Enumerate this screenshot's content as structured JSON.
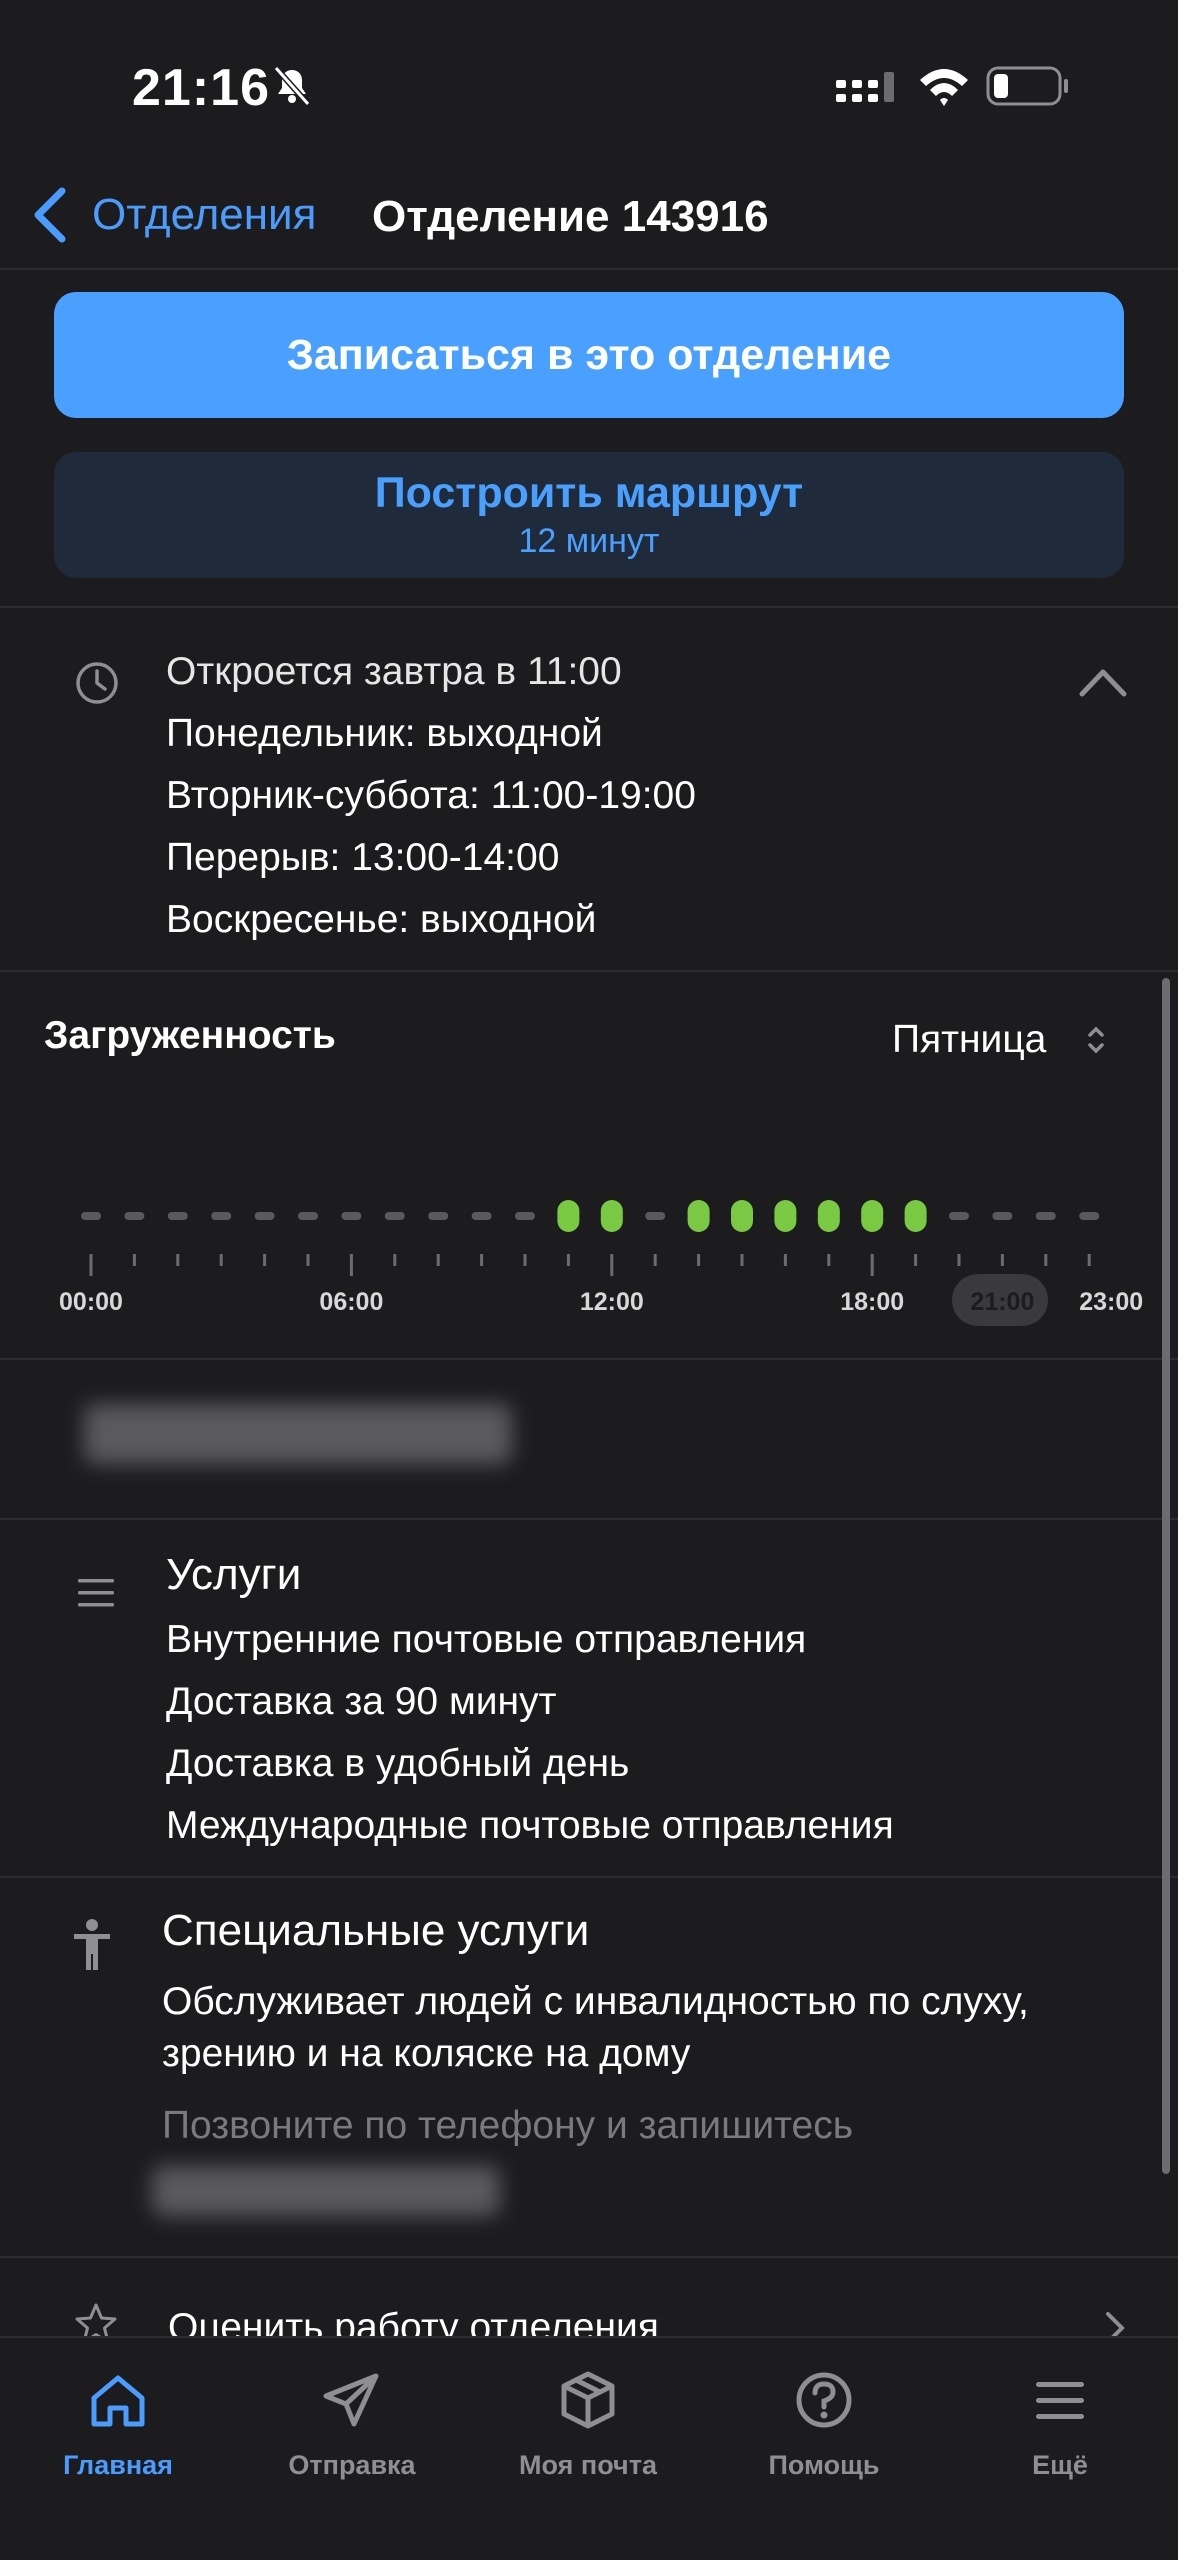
{
  "status": {
    "time": "21:16"
  },
  "nav": {
    "back_label": "Отделения",
    "title": "Отделение 143916"
  },
  "actions": {
    "book_label": "Записаться в это отделение",
    "route_label": "Построить маршрут",
    "route_time": "12 минут"
  },
  "hours": {
    "next_open": "Откроется завтра в 11:00",
    "lines": [
      "Понедельник: выходной",
      "Вторник-суббота: 11:00-19:00",
      "Перерыв: 13:00-14:00",
      "Воскресенье: выходной"
    ]
  },
  "load": {
    "title": "Загруженность",
    "day": "Пятница",
    "tick_labels": [
      "00:00",
      "06:00",
      "12:00",
      "18:00",
      "21:00",
      "23:00"
    ],
    "current_hour": "21:00",
    "active_hours": [
      11,
      12,
      14,
      15,
      16,
      17,
      18,
      19
    ],
    "colors": {
      "active": "#7ac943",
      "inactive": "#5a5a5e"
    }
  },
  "services": {
    "title": "Услуги",
    "items": [
      "Внутренние почтовые отправления",
      "Доставка за 90 минут",
      "Доставка в удобный день",
      "Международные почтовые отправления"
    ]
  },
  "special": {
    "title": "Специальные услуги",
    "description": "Обслуживает людей с инвалидностью по слуху, зрению и на коляске на дому",
    "call_hint": "Позвоните по телефону и запишитесь"
  },
  "rate": {
    "label": "Оценить работу отделения"
  },
  "tabs": [
    {
      "label": "Главная",
      "icon": "home-icon",
      "active": true
    },
    {
      "label": "Отправка",
      "icon": "send-icon",
      "active": false
    },
    {
      "label": "Моя почта",
      "icon": "box-icon",
      "active": false
    },
    {
      "label": "Помощь",
      "icon": "help-icon",
      "active": false
    },
    {
      "label": "Ещё",
      "icon": "menu-icon",
      "active": false
    }
  ],
  "colors": {
    "accent": "#4aa0ff",
    "background": "#1c1c1e"
  }
}
